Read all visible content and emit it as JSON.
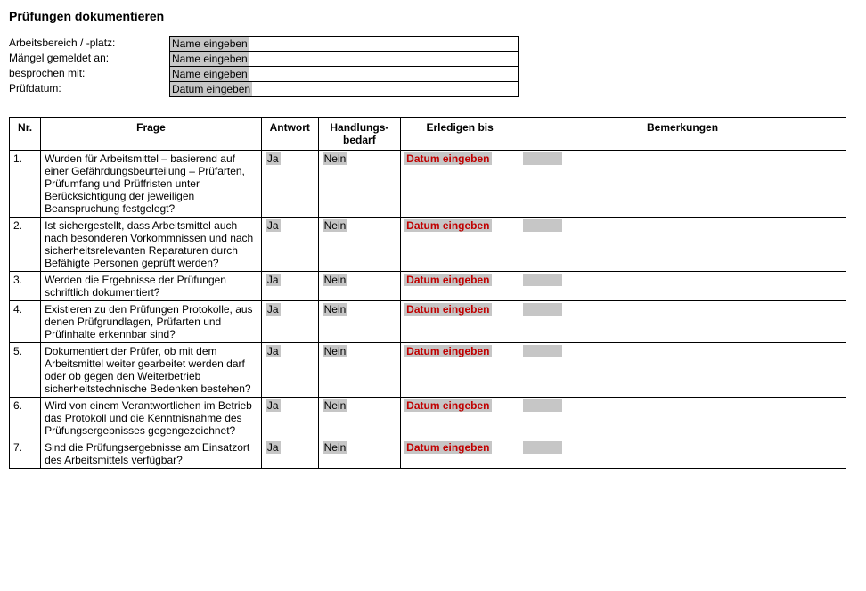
{
  "title": "Prüfungen dokumentieren",
  "meta": {
    "rows": [
      {
        "label": "Arbeitsbereich / -platz:",
        "placeholder": "Name eingeben"
      },
      {
        "label": "Mängel gemeldet an:",
        "placeholder": "Name eingeben"
      },
      {
        "label": "besprochen mit:",
        "placeholder": "Name eingeben"
      },
      {
        "label": "Prüfdatum:",
        "placeholder": "Datum eingeben"
      }
    ]
  },
  "table": {
    "headers": {
      "nr": "Nr.",
      "frage": "Frage",
      "antwort": "Antwort",
      "handlung_l1": "Handlungs-",
      "handlung_l2": "bedarf",
      "erledigen": "Erledigen bis",
      "bemerkungen": "Bemerkungen"
    },
    "rows": [
      {
        "nr": "1.",
        "frage": "Wurden für Arbeitsmittel – basierend auf einer Gefährdungsbeurteilung – Prüfarten, Prüfumfang und Prüffristen unter Berücksichtigung der jeweiligen Beanspruchung festgelegt?",
        "antwort": "Ja",
        "handlung": "Nein",
        "erledigen": "Datum eingeben"
      },
      {
        "nr": "2.",
        "frage": "Ist sichergestellt, dass Arbeitsmittel auch nach besonderen Vorkommnissen und nach sicherheitsrelevanten Reparaturen durch Befähigte Personen geprüft werden?",
        "antwort": "Ja",
        "handlung": "Nein",
        "erledigen": "Datum eingeben"
      },
      {
        "nr": "3.",
        "frage": "Werden die Ergebnisse der Prüfungen schriftlich dokumentiert?",
        "antwort": "Ja",
        "handlung": "Nein",
        "erledigen": "Datum eingeben"
      },
      {
        "nr": "4.",
        "frage": "Existieren zu den Prüfungen Protokolle, aus denen Prüfgrundlagen, Prüfarten und Prüfinhalte erkennbar sind?",
        "antwort": "Ja",
        "handlung": "Nein",
        "erledigen": "Datum eingeben"
      },
      {
        "nr": "5.",
        "frage": "Dokumentiert der Prüfer, ob mit dem Arbeitsmittel weiter gearbeitet werden darf oder ob gegen den Weiterbetrieb sicherheitstechnische Bedenken bestehen?",
        "antwort": "Ja",
        "handlung": "Nein",
        "erledigen": "Datum eingeben"
      },
      {
        "nr": "6.",
        "frage": "Wird von einem Verantwortlichen im Betrieb das Protokoll und die Kenntnisnahme des Prüfungsergebnisses gegengezeichnet?",
        "antwort": "Ja",
        "handlung": "Nein",
        "erledigen": "Datum eingeben"
      },
      {
        "nr": "7.",
        "frage": "Sind die Prüfungsergebnisse am Einsatzort des Arbeitsmittels verfügbar?",
        "antwort": "Ja",
        "handlung": "Nein",
        "erledigen": "Datum eingeben"
      }
    ]
  }
}
